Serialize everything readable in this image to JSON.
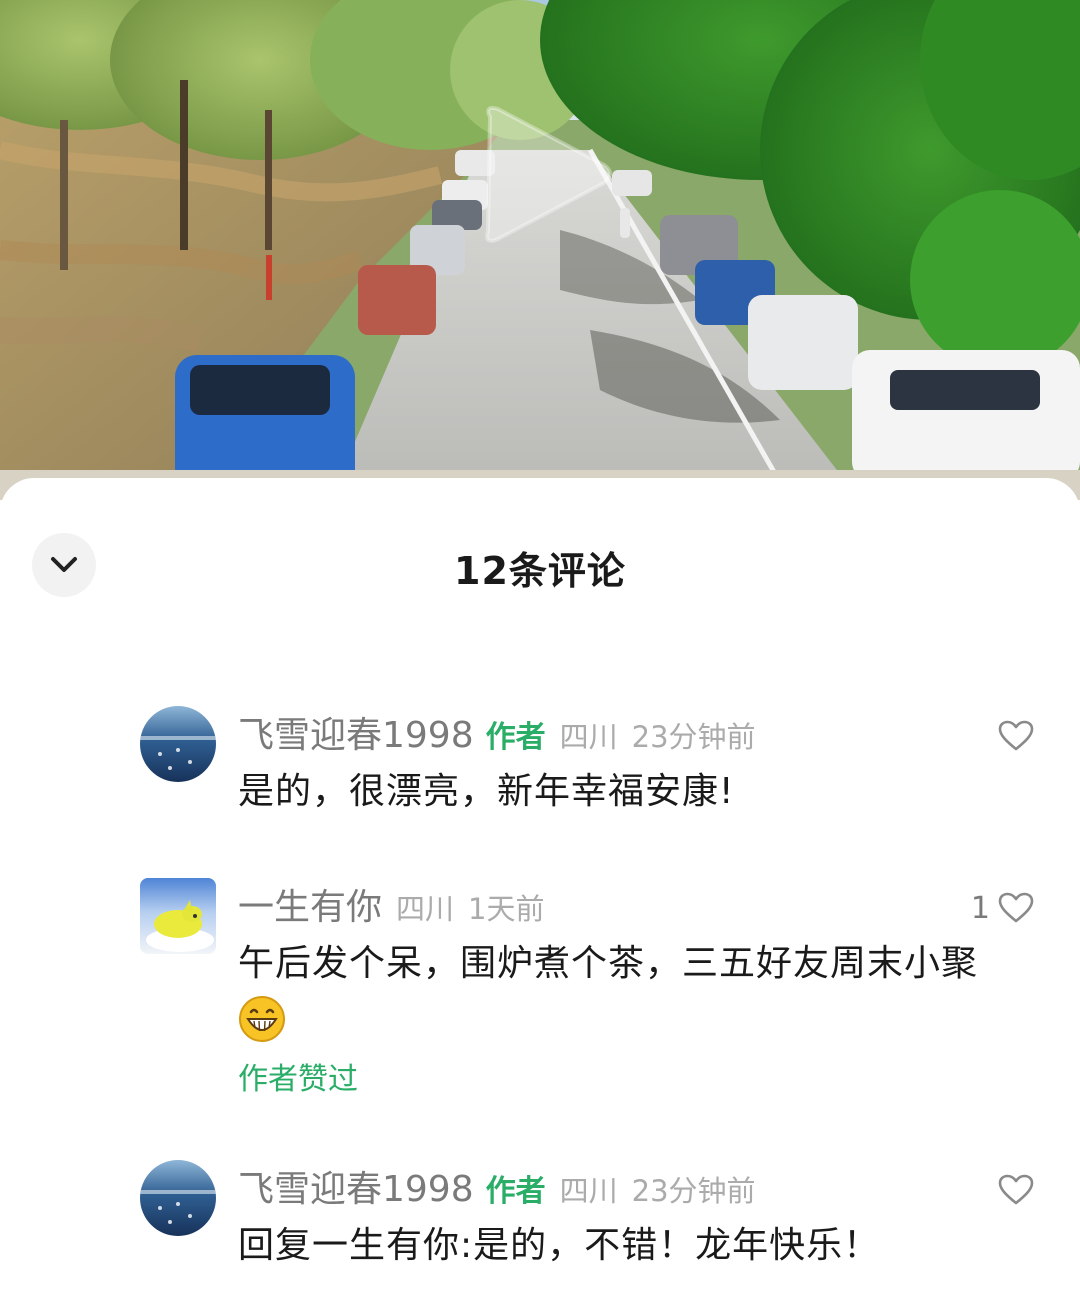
{
  "sheet": {
    "title": "12条评论"
  },
  "icons": {
    "collapse": "chevron-down-icon",
    "like": "heart-outline-icon",
    "play": "play-icon",
    "emoji": "grinning-face-emoji-icon"
  },
  "colors": {
    "author_tag": "#2aae67",
    "username": "#7a7a7a",
    "meta": "#ababab",
    "text": "#1a1a1a"
  },
  "comments": [
    {
      "username": "飞雪迎春1998",
      "author_tag": "作者",
      "location": "四川",
      "time": "23分钟前",
      "like_count": "",
      "text": "是的，很漂亮，新年幸福安康!",
      "avatar": "lake-avatar"
    },
    {
      "username": "一生有你",
      "author_tag": "",
      "location": "四川",
      "time": "1天前",
      "like_count": "1",
      "text": "午后发个呆，围炉煮个茶，三五好友周末小聚",
      "emoji": "grinning-face",
      "liked_by_author": "作者赞过",
      "avatar": "yellow-toy-avatar"
    },
    {
      "username": "飞雪迎春1998",
      "author_tag": "作者",
      "location": "四川",
      "time": "23分钟前",
      "like_count": "",
      "text": "回复一生有你:是的，不错！龙年快乐！",
      "avatar": "lake-avatar"
    }
  ]
}
